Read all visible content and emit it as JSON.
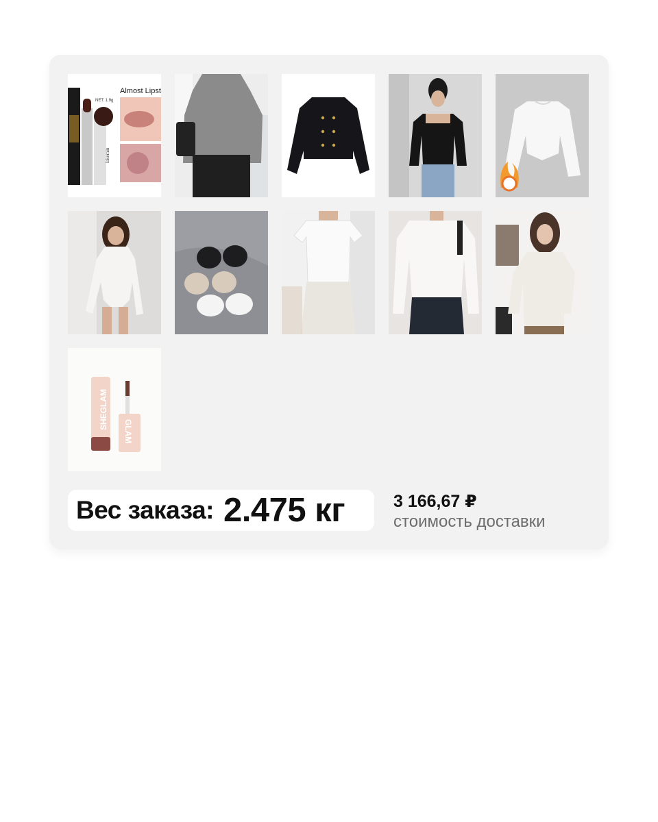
{
  "order": {
    "weight_label": "Вес заказа:",
    "weight_value": "2.475 кг",
    "delivery_price": "3 166,67 ₽",
    "delivery_caption": "стоимость доставки"
  },
  "products": [
    {
      "name": "lipstick-kit",
      "label": "Almost Lipst",
      "net": "NET: 1.9g",
      "brand": "lakerain"
    },
    {
      "name": "grey-cardigan"
    },
    {
      "name": "black-tweed-jacket"
    },
    {
      "name": "black-square-neck-top"
    },
    {
      "name": "white-ruched-top"
    },
    {
      "name": "white-bodysuit"
    },
    {
      "name": "bras-set"
    },
    {
      "name": "white-tshirt-outfit"
    },
    {
      "name": "white-ribbed-sweater"
    },
    {
      "name": "white-shirt-outfit"
    },
    {
      "name": "sheglam-lip-gloss",
      "brand": "SHEGLAM",
      "brand2": "GLAM"
    }
  ],
  "colors": {
    "card_bg": "#f2f2f2",
    "caption_gray": "#6d6d6d"
  }
}
